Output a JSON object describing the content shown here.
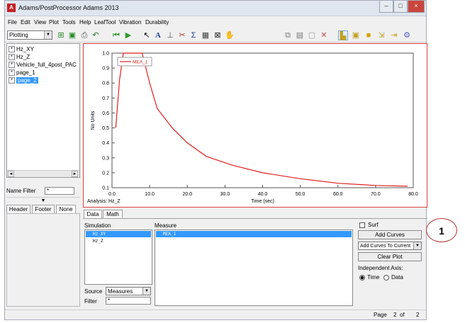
{
  "window": {
    "title": "Adams/PostProcessor Adams 2013",
    "app_icon": "A",
    "min": "–",
    "max": "□",
    "close": "×"
  },
  "menu": [
    "File",
    "Edit",
    "View",
    "Plot",
    "Tools",
    "Help",
    "LeafTool",
    "Vibration",
    "Durability"
  ],
  "toolbar": {
    "mode": "Plotting"
  },
  "tree": {
    "items": [
      {
        "label": "Hz_XY",
        "expander": "+"
      },
      {
        "label": "Hz_Z",
        "expander": "+"
      },
      {
        "label": "Vehicle_full_4post_PAC",
        "expander": "+"
      },
      {
        "label": "page_1",
        "expander": "+"
      },
      {
        "label": "page_2",
        "expander": "+"
      }
    ],
    "scroll_left": "◄",
    "scroll_right": "►"
  },
  "name_filter": {
    "label": "Name Filter",
    "value": "*"
  },
  "left_tabs": [
    "Header",
    "Footer",
    "None"
  ],
  "chart_data": {
    "type": "line",
    "series": [
      {
        "name": "MEA_1",
        "color": "#e02020",
        "x": [
          1.0,
          2.0,
          3.0,
          4.0,
          6.0,
          8.0,
          9.0,
          10.0,
          12.0,
          16.0,
          20.0,
          25.0,
          32.0,
          40.0,
          50.0,
          60.0,
          70.0,
          78.5
        ],
        "y": [
          0.5,
          0.82,
          1.0,
          1.0,
          1.0,
          1.0,
          0.9,
          0.8,
          0.63,
          0.5,
          0.4,
          0.31,
          0.25,
          0.2,
          0.16,
          0.13,
          0.115,
          0.11
        ]
      }
    ],
    "xlabel": "Time (sec)",
    "ylabel": "No Units",
    "xlim": [
      0,
      80
    ],
    "ylim": [
      0.1,
      1.0
    ],
    "xticks": [
      "0.0",
      "10.0",
      "20.0",
      "30.0",
      "40.0",
      "50.0",
      "60.0",
      "70.0",
      "80.0"
    ],
    "yticks": [
      "0.1",
      "0.2",
      "0.3",
      "0.4",
      "0.5",
      "0.6",
      "0.7",
      "0.8",
      "0.9",
      "1.0"
    ],
    "analysis": "Analysis:  Hz_Z",
    "grid": true,
    "legend": "top-left"
  },
  "bottom_tabs": [
    "Data",
    "Math"
  ],
  "simulation": {
    "label": "Simulation",
    "items": [
      "Hz_XY",
      "Hz_Z"
    ]
  },
  "measure": {
    "label": "Measure",
    "items": [
      "MEA_1"
    ]
  },
  "source": {
    "label": "Source",
    "value": "Measures"
  },
  "filter": {
    "label": "Filter",
    "value": "*"
  },
  "right_panel": {
    "surf": "Surf",
    "add_curves": "Add Curves",
    "add_mode": "Add Curves To Current",
    "clear_plot": "Clear Plot",
    "independent_axis": "Independent Axis:",
    "time": "Time",
    "data": "Data"
  },
  "status": {
    "page_label": "Page",
    "page": "2",
    "of_label": "of",
    "total": "2"
  },
  "callout": {
    "number": "1"
  }
}
